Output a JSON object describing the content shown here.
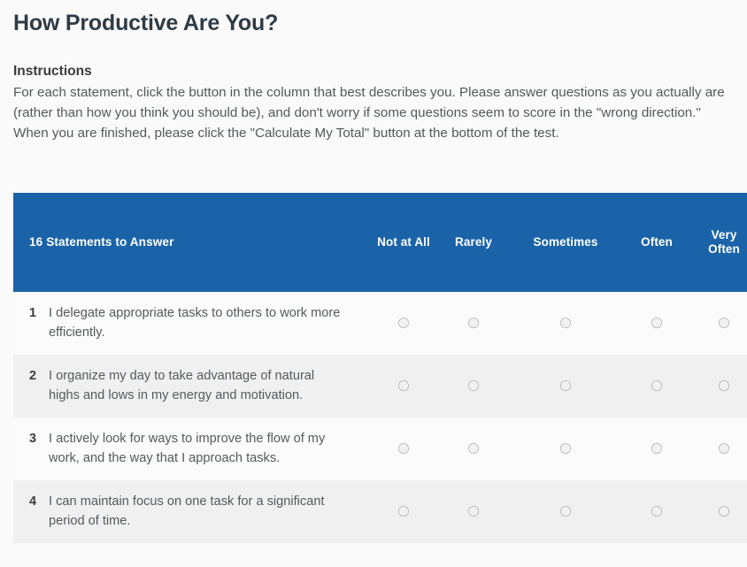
{
  "page": {
    "title": "How Productive Are You?"
  },
  "instructions": {
    "heading": "Instructions",
    "body": "For each statement, click the button in the column that best describes you. Please answer questions as you actually are (rather than how you think you should be), and don't worry if some questions seem to score in the \"wrong direction.\" When you are finished, please click the \"Calculate My Total\" button at the bottom of the test."
  },
  "table": {
    "header": {
      "statements_label": "16 Statements to Answer",
      "options": [
        "Not at All",
        "Rarely",
        "Sometimes",
        "Often",
        "Very Often"
      ],
      "background_color": "#1b63a8",
      "text_color": "#ffffff"
    },
    "rows": [
      {
        "number": "1",
        "statement": "I delegate appropriate tasks to others to work more efficiently."
      },
      {
        "number": "2",
        "statement": "I organize my day to take advantage of natural highs and lows in my energy and motivation."
      },
      {
        "number": "3",
        "statement": "I actively look for ways to improve the flow of my work, and the way that I approach tasks."
      },
      {
        "number": "4",
        "statement": "I can maintain focus on one task for a significant period of time."
      }
    ]
  }
}
